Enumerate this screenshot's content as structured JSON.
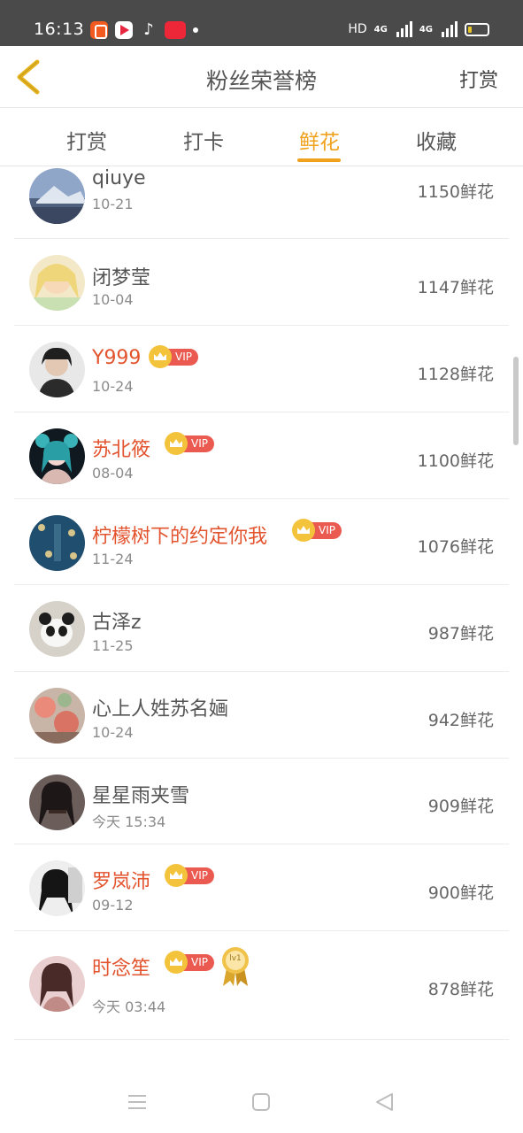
{
  "status_bar": {
    "time": "16:13",
    "right_label": "HD",
    "net1": "4G",
    "net2": "4G",
    "app_icons": [
      "kuaishou-icon",
      "video-app-icon",
      "tiktok-icon",
      "redbook-icon"
    ]
  },
  "header": {
    "title": "粉丝荣誉榜",
    "action_label": "打赏",
    "back_icon": "chevron-left-icon"
  },
  "tabs": [
    {
      "label": "打赏",
      "active": false
    },
    {
      "label": "打卡",
      "active": false
    },
    {
      "label": "鲜花",
      "active": true
    },
    {
      "label": "收藏",
      "active": false
    }
  ],
  "list": [
    {
      "name": "qiuye",
      "date": "10-21",
      "count": "1150鲜花",
      "vip": false
    },
    {
      "name": "闭梦莹",
      "date": "10-04",
      "count": "1147鲜花",
      "vip": false
    },
    {
      "name": "Y999",
      "date": "10-24",
      "count": "1128鲜花",
      "vip": true,
      "vip_label": "VIP"
    },
    {
      "name": "苏北筱",
      "date": "08-04",
      "count": "1100鲜花",
      "vip": true,
      "vip_label": "VIP"
    },
    {
      "name": "柠檬树下的约定你我",
      "date": "11-24",
      "count": "1076鲜花",
      "vip": true,
      "vip_label": "VIP"
    },
    {
      "name": "古泽z",
      "date": "11-25",
      "count": "987鲜花",
      "vip": false
    },
    {
      "name": "心上人姓苏名婳",
      "date": "10-24",
      "count": "942鲜花",
      "vip": false
    },
    {
      "name": "星星雨夹雪",
      "date": "今天 15:34",
      "count": "909鲜花",
      "vip": false
    },
    {
      "name": "罗岚沛",
      "date": "09-12",
      "count": "900鲜花",
      "vip": true,
      "vip_label": "VIP"
    },
    {
      "name": "时念笙",
      "date": "今天 03:44",
      "count": "878鲜花",
      "vip": true,
      "vip_label": "VIP",
      "level_badge": "lv1"
    }
  ],
  "colors": {
    "accent": "#f0a21c",
    "vip_name": "#e2532e",
    "vip_pill": "#ea5a50",
    "crown": "#f4c33c"
  }
}
